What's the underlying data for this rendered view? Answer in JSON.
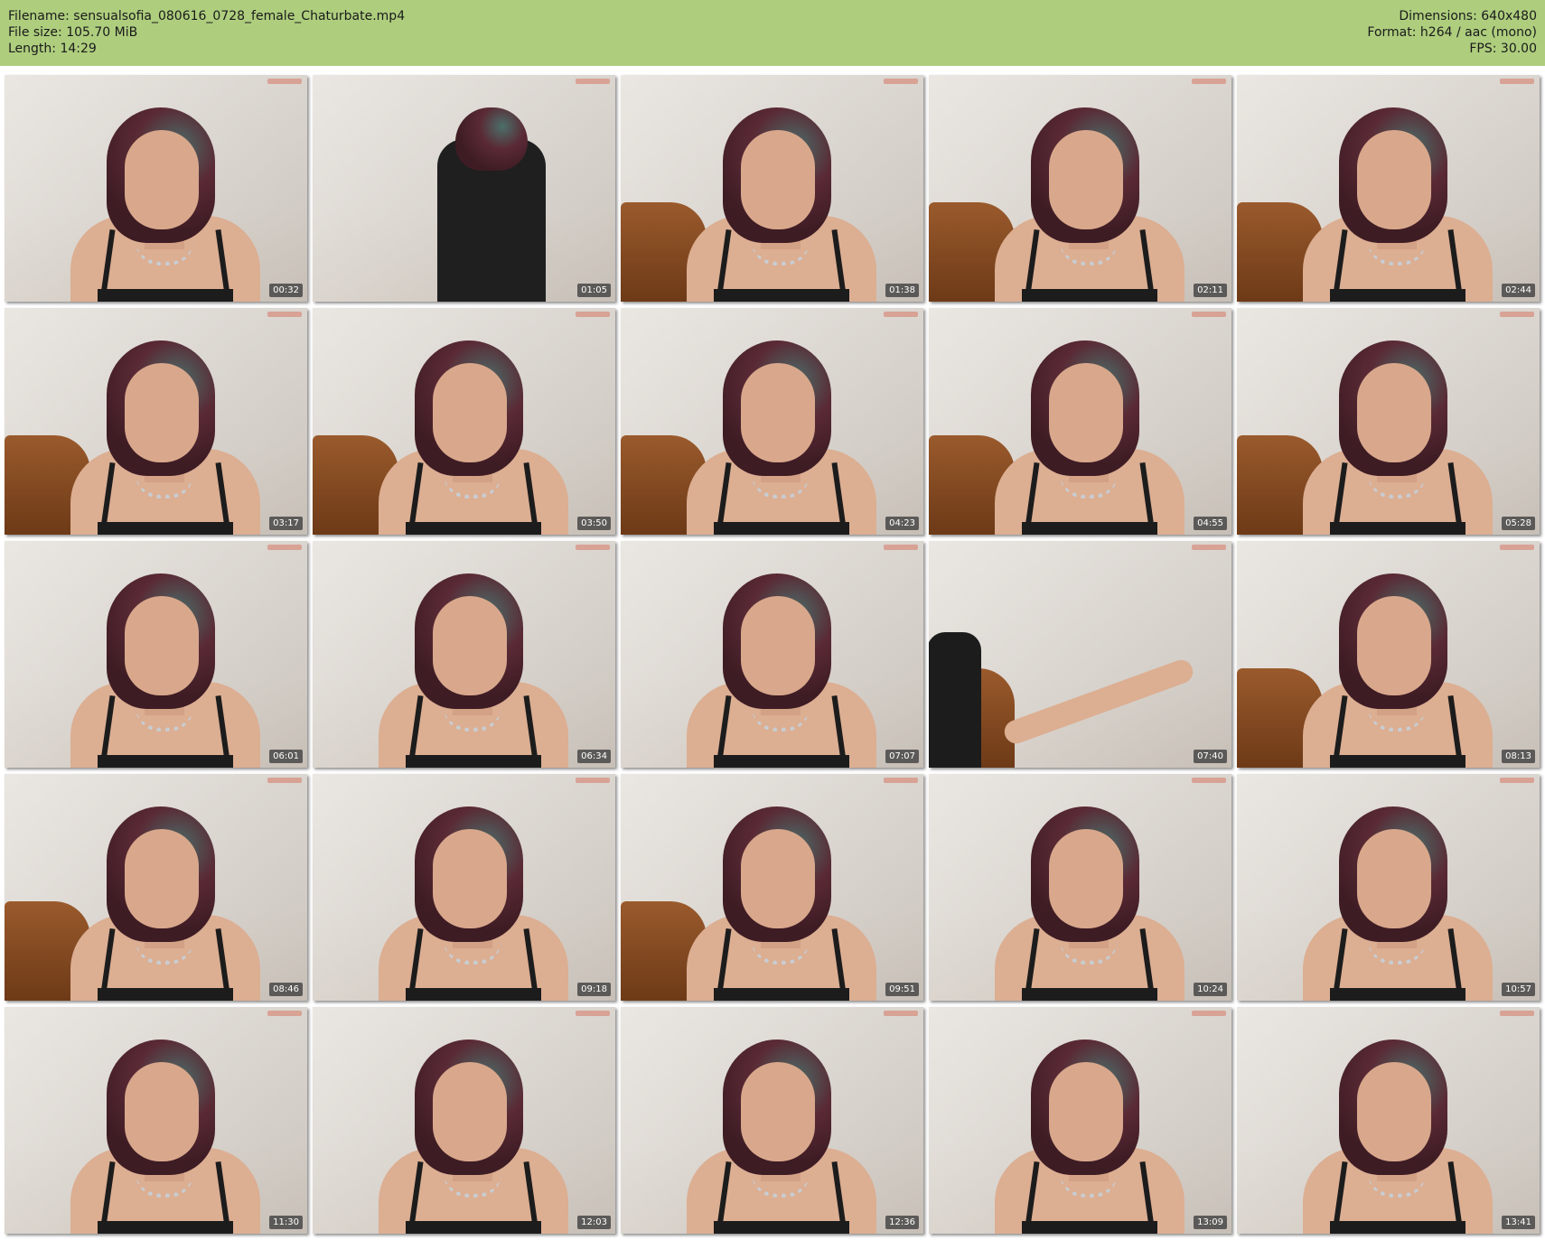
{
  "info": {
    "filename": "Filename: sensualsofia_080616_0728_female_Chaturbate.mp4",
    "filesize": "File size: 105.70 MiB",
    "length": "Length: 14:29",
    "dimensions": "Dimensions: 640x480",
    "format": "Format: h264 / aac (mono)",
    "fps": "FPS: 30.00"
  },
  "colors": {
    "header_bg": "#aece7e",
    "timestamp_bg": "#3c3c3c"
  },
  "thumbnails": [
    {
      "time": "00:32",
      "scene": "portrait"
    },
    {
      "time": "01:05",
      "scene": "dress"
    },
    {
      "time": "01:38",
      "scene": "portrait-bed"
    },
    {
      "time": "02:11",
      "scene": "portrait-bed"
    },
    {
      "time": "02:44",
      "scene": "portrait-bed"
    },
    {
      "time": "03:17",
      "scene": "portrait-bed"
    },
    {
      "time": "03:50",
      "scene": "portrait-bed"
    },
    {
      "time": "04:23",
      "scene": "portrait-bed"
    },
    {
      "time": "04:55",
      "scene": "portrait-bed"
    },
    {
      "time": "05:28",
      "scene": "portrait-bed"
    },
    {
      "time": "06:01",
      "scene": "portrait"
    },
    {
      "time": "06:34",
      "scene": "portrait"
    },
    {
      "time": "07:07",
      "scene": "portrait"
    },
    {
      "time": "07:40",
      "scene": "legs"
    },
    {
      "time": "08:13",
      "scene": "portrait-bed"
    },
    {
      "time": "08:46",
      "scene": "portrait-bed"
    },
    {
      "time": "09:18",
      "scene": "portrait"
    },
    {
      "time": "09:51",
      "scene": "portrait-bed"
    },
    {
      "time": "10:24",
      "scene": "portrait"
    },
    {
      "time": "10:57",
      "scene": "portrait"
    },
    {
      "time": "11:30",
      "scene": "portrait"
    },
    {
      "time": "12:03",
      "scene": "portrait"
    },
    {
      "time": "12:36",
      "scene": "portrait"
    },
    {
      "time": "13:09",
      "scene": "portrait"
    },
    {
      "time": "13:41",
      "scene": "portrait"
    }
  ]
}
